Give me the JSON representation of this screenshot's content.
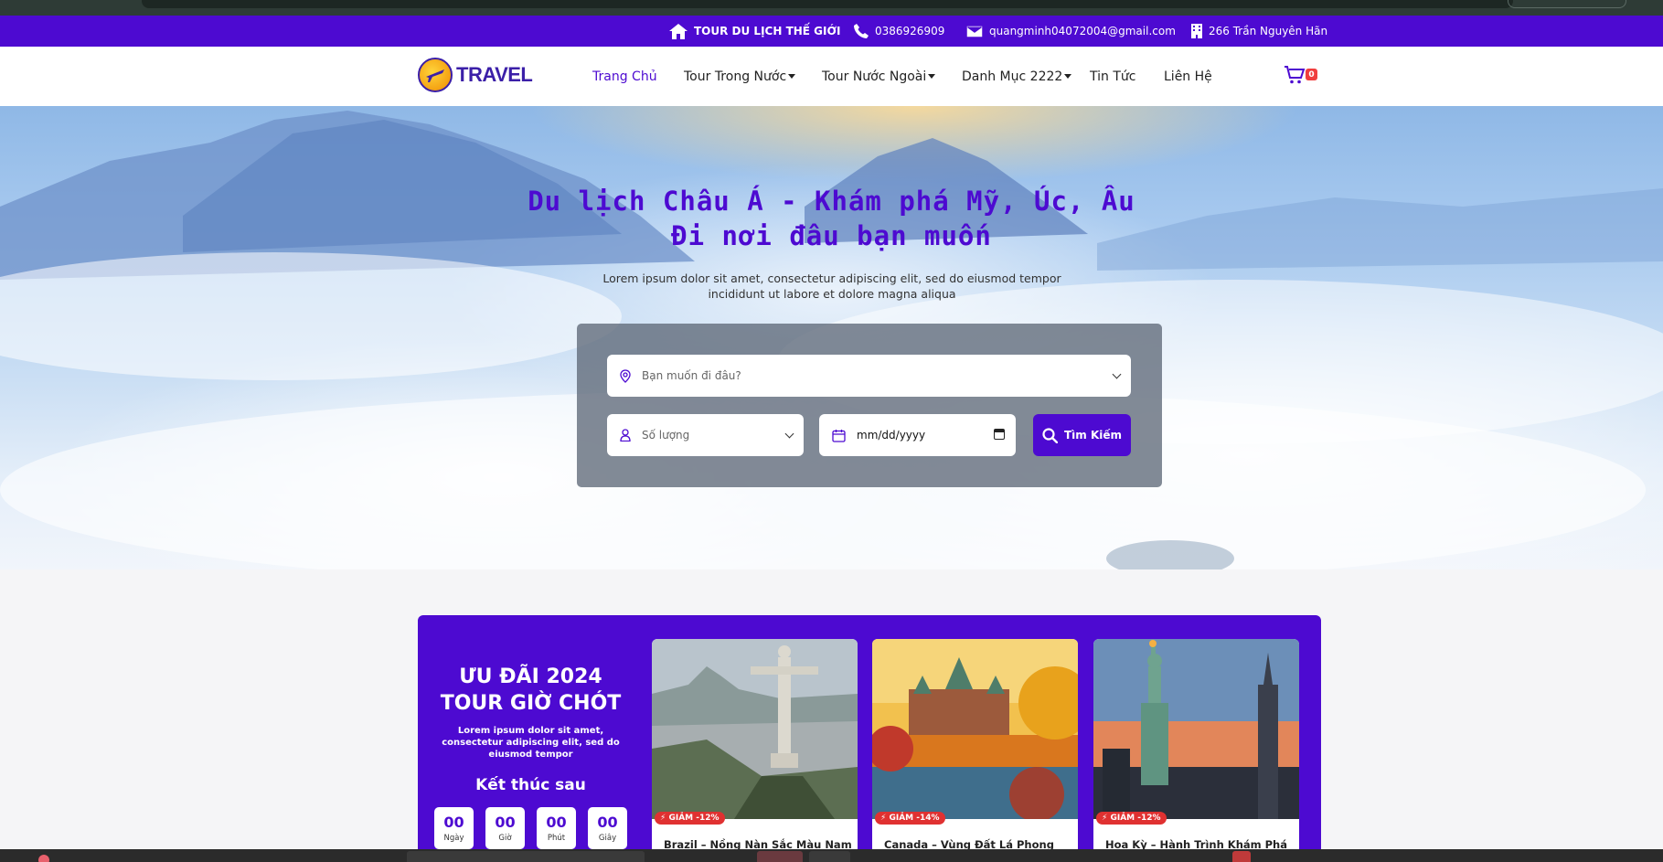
{
  "topbar": {
    "tour": "TOUR DU LỊCH THẾ GIỚI",
    "phone": "0386926909",
    "email": "quangminh04072004@gmail.com",
    "address": "266 Trần Nguyên Hãn"
  },
  "logo": {
    "text": "TRAVEL"
  },
  "nav": {
    "home": "Trang Chủ",
    "domestic": "Tour Trong Nước",
    "foreign": "Tour Nước Ngoài",
    "category": "Danh Mục 2222",
    "news": "Tin Tức",
    "contact": "Liên Hệ"
  },
  "cart": {
    "count": "0"
  },
  "hero": {
    "title_line1": "Du lịch Châu Á - Khám phá Mỹ, Úc, Âu",
    "title_line2": "Đi nơi đâu bạn muốn",
    "subtitle": "Lorem ipsum dolor sit amet, consectetur adipiscing elit, sed do eiusmod tempor incididunt ut labore et dolore magna aliqua"
  },
  "search": {
    "destination_placeholder": "Bạn muốn đi đâu?",
    "quantity_placeholder": "Số lượng",
    "date_value": "mm/dd/yyyy",
    "button": "Tìm Kiếm"
  },
  "promo": {
    "title_line1": "ƯU ĐÃI 2024",
    "title_line2": "TOUR GIỜ CHÓT",
    "description": "Lorem ipsum dolor sit amet, consectetur adipiscing elit, sed do eiusmod tempor",
    "ends_label": "Kết thúc sau",
    "countdown": [
      {
        "value": "00",
        "label": "Ngày"
      },
      {
        "value": "00",
        "label": "Giờ"
      },
      {
        "value": "00",
        "label": "Phút"
      },
      {
        "value": "00",
        "label": "Giây"
      }
    ],
    "cards": [
      {
        "discount": "GIẢM -12%",
        "title": "Brazil – Nồng Nàn Sắc Màu Nam"
      },
      {
        "discount": "GIẢM -14%",
        "title": "Canada – Vùng Đất Lá Phong"
      },
      {
        "discount": "GIẢM -12%",
        "title": "Hoa Kỳ – Hành Trình Khám Phá"
      }
    ]
  },
  "colors": {
    "primary": "#4d0ad1",
    "discount": "#e03131",
    "cart_badge": "#f03e3e"
  }
}
